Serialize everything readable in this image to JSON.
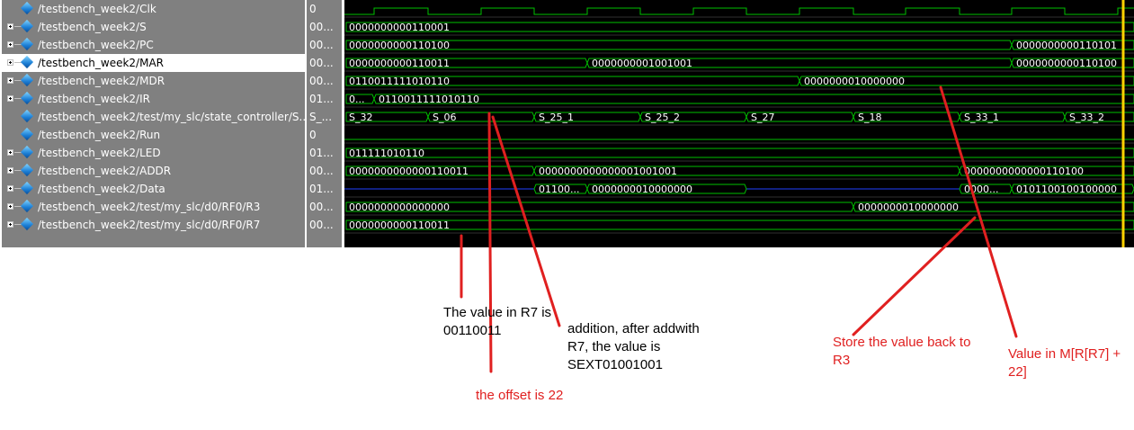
{
  "signals": [
    {
      "name": "/testbench_week2/Clk",
      "value": "0",
      "expandable": false,
      "selected": false
    },
    {
      "name": "/testbench_week2/S",
      "value": "00...",
      "expandable": true,
      "selected": false
    },
    {
      "name": "/testbench_week2/PC",
      "value": "00...",
      "expandable": true,
      "selected": false
    },
    {
      "name": "/testbench_week2/MAR",
      "value": "00...",
      "expandable": true,
      "selected": true
    },
    {
      "name": "/testbench_week2/MDR",
      "value": "00...",
      "expandable": true,
      "selected": false
    },
    {
      "name": "/testbench_week2/IR",
      "value": "01...",
      "expandable": true,
      "selected": false
    },
    {
      "name": "/testbench_week2/test/my_slc/state_controller/S...",
      "value": "S_...",
      "expandable": false,
      "selected": false
    },
    {
      "name": "/testbench_week2/Run",
      "value": "0",
      "expandable": false,
      "selected": false
    },
    {
      "name": "/testbench_week2/LED",
      "value": "01...",
      "expandable": true,
      "selected": false
    },
    {
      "name": "/testbench_week2/ADDR",
      "value": "00...",
      "expandable": true,
      "selected": false
    },
    {
      "name": "/testbench_week2/Data",
      "value": "01...",
      "expandable": true,
      "selected": false
    },
    {
      "name": "/testbench_week2/test/my_slc/d0/RF0/R3",
      "value": "00...",
      "expandable": true,
      "selected": false
    },
    {
      "name": "/testbench_week2/test/my_slc/d0/RF0/R7",
      "value": "00...",
      "expandable": true,
      "selected": false
    }
  ],
  "waves": {
    "S": [
      "0000000000110001"
    ],
    "PC": [
      "0000000000110100",
      "0000000000110101"
    ],
    "MAR": [
      "0000000000110011",
      "0000000001001001",
      "0000000000110100"
    ],
    "MDR": [
      "0110011111010110",
      "0000000010000000"
    ],
    "IR": [
      "0...",
      "0110011111010110"
    ],
    "State": [
      "S_32",
      "S_06",
      "S_25_1",
      "S_25_2",
      "S_27",
      "S_18",
      "S_33_1",
      "S_33_2"
    ],
    "LED": [
      "011111010110"
    ],
    "ADDR": [
      "0000000000000110011",
      "0000000000000001001001",
      "0000000000000110100"
    ],
    "Data": [
      "01100...",
      "0000000010000000",
      "0000...",
      "0101100100100000"
    ],
    "R3": [
      "0000000000000000",
      "0000000010000000"
    ],
    "R7": [
      "0000000000110011"
    ]
  },
  "annotations": {
    "r7_value": "The value in R7 is\n00110011",
    "offset": "the offset is 22",
    "addition": "addition, after addwith\nR7, the value is\nSEXT01001001",
    "store": "Store the value back to\nR3",
    "mem_value": "Value in M[R[R7] +\n22]"
  },
  "colors": {
    "panel": "#808080",
    "wave_bg": "#000000",
    "wave_green": "#00c000",
    "data_bus": "#2040ff",
    "cursor": "#ffd200",
    "annotation_red": "#e02020",
    "annotation_black": "#000000"
  }
}
